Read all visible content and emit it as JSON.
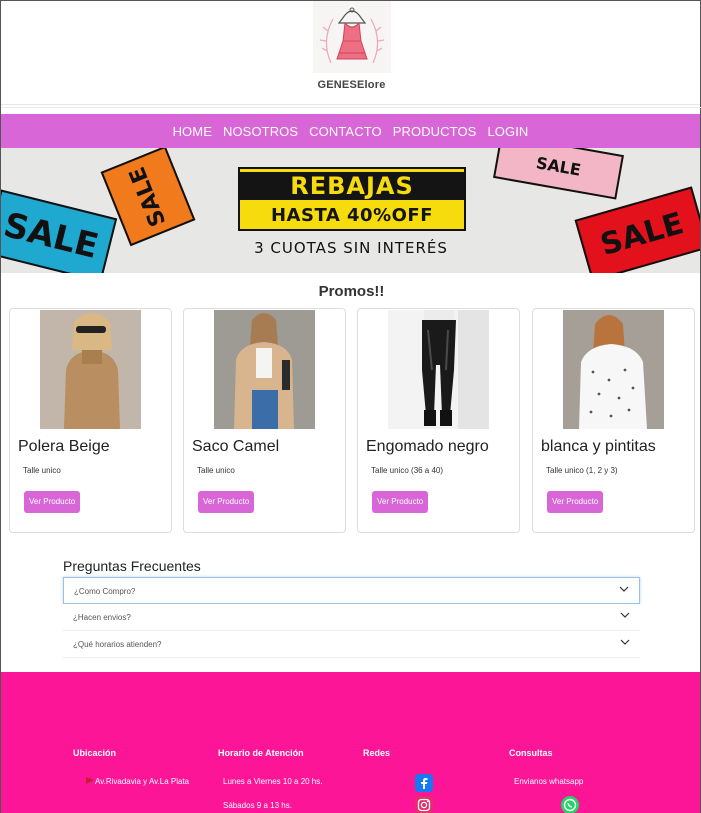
{
  "brand": {
    "name": "GENESElore"
  },
  "nav": [
    "HOME",
    "NOSOTROS",
    "CONTACTO",
    "PRODUCTOS",
    "LOGIN"
  ],
  "banner": {
    "headline": "REBAJAS",
    "discount": "HASTA 40%OFF",
    "installments": "3 CUOTAS SIN INTERÉS",
    "sale_text": "SALE",
    "colors": {
      "bg": "#e7e7e5",
      "yellow": "#f6dc0c",
      "blue": "#1fa8d0",
      "orange": "#f07a1c",
      "pink": "#f2b6c6",
      "red": "#e3111b"
    }
  },
  "promos": {
    "title": "Promos!!",
    "products": [
      {
        "name": "Polera Beige",
        "size": "Talle unico",
        "button": "Ver Producto"
      },
      {
        "name": "Saco Camel",
        "size": "Talle unico",
        "button": "Ver Producto"
      },
      {
        "name": "Engomado negro",
        "size": "Talle unico (36 a 40)",
        "button": "Ver Producto"
      },
      {
        "name": "blanca y pintitas",
        "size": "Talle unico (1, 2 y 3)",
        "button": "Ver Producto"
      }
    ]
  },
  "faq": {
    "title": "Preguntas Frecuentes",
    "items": [
      "¿Como Compro?",
      "¿Hacen envios?",
      "¿Qué horarios atienden?"
    ]
  },
  "footer": {
    "location_title": "Ubicación",
    "location": "Av.Rivadavia y Av.La Plata",
    "hours_title": "Horario de Atención",
    "hours_week": "Lunes a Viernes 10 a 20 hs.",
    "hours_sat": "Sábados 9 a 13 hs.",
    "social_title": "Redes",
    "contact_title": "Consultas",
    "contact": "Envianos whatsapp"
  },
  "colors": {
    "accent": "#d966d6",
    "footer": "#fc1596"
  }
}
